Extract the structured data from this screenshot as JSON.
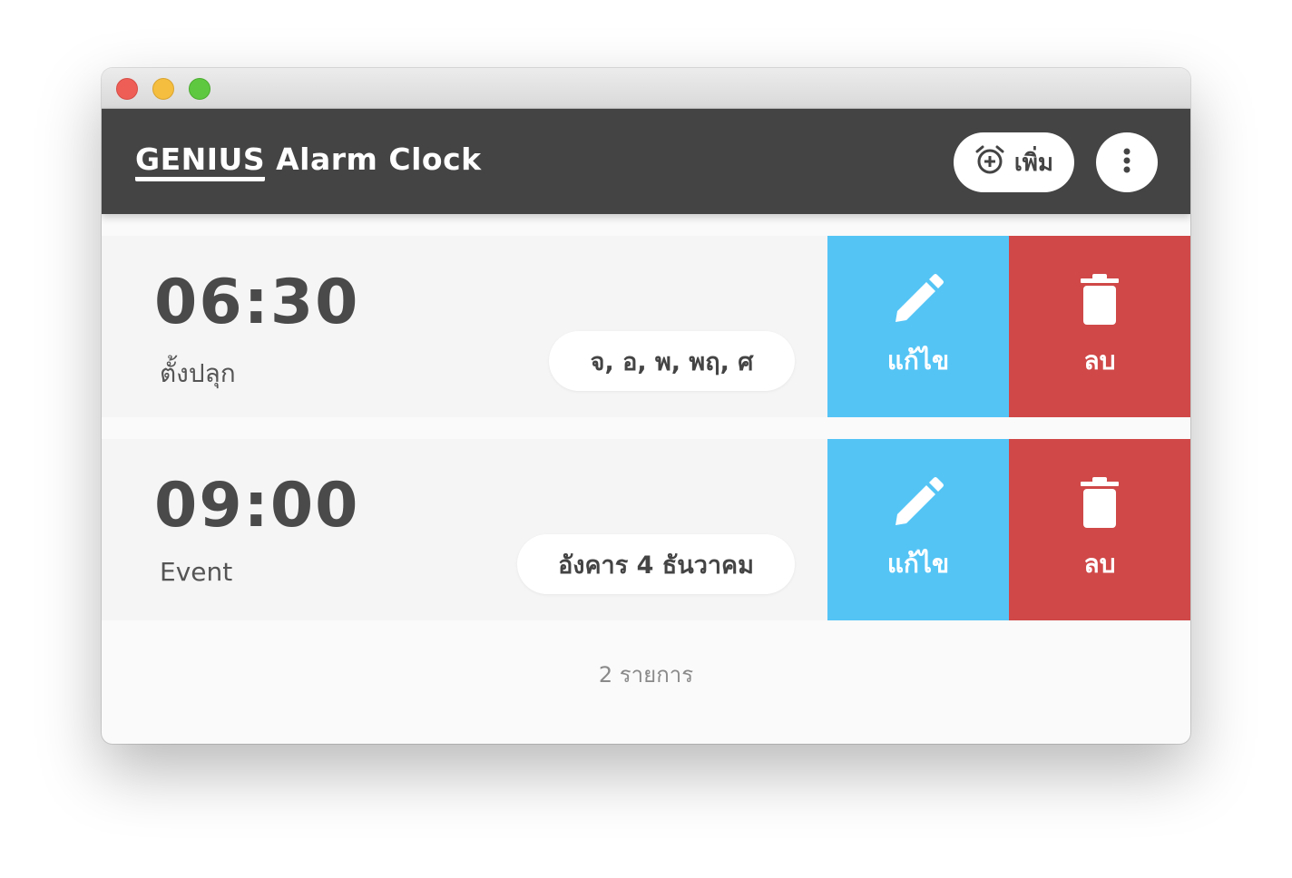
{
  "app": {
    "brand_strong": "GENIUS",
    "brand_rest": "Alarm Clock",
    "add_label": "เพิ่ม"
  },
  "icons": {
    "add": "alarm-add-icon",
    "menu": "more-vert-icon",
    "edit": "pencil-icon",
    "delete": "trash-icon"
  },
  "colors": {
    "appbar": "#444444",
    "edit": "#54c4f5",
    "delete": "#d04848",
    "row": "#f5f5f5"
  },
  "alarms": [
    {
      "time": "06:30",
      "label": "ตั้งปลุก",
      "schedule": "จ, อ, พ, พฤ, ศ",
      "edit_label": "แก้ไข",
      "delete_label": "ลบ"
    },
    {
      "time": "09:00",
      "label": "Event",
      "schedule": "อังคาร 4 ธันวาคม",
      "edit_label": "แก้ไข",
      "delete_label": "ลบ"
    }
  ],
  "footer": {
    "count_text": "2 รายการ"
  }
}
